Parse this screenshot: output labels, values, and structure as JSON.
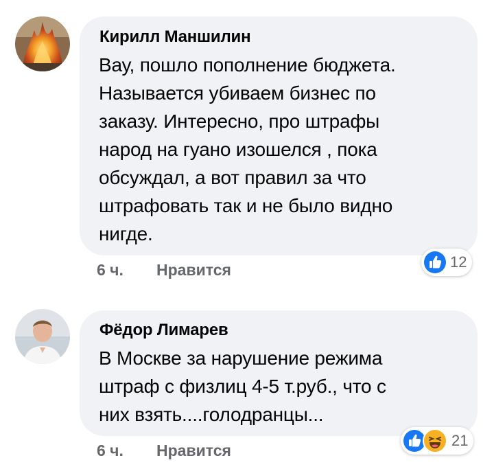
{
  "comments": [
    {
      "author": "Кирилл Маншилин",
      "text": "Вау, пошло пополнение бюджета.\nНазывается убиваем бизнес по\nзаказу. Интересно, про штрафы\nнарод на гуано изошелся , пока\nобсуждал, а вот правил за что\nштрафовать так и не было видно\nнигде.",
      "time": "6 ч.",
      "like_label": "Нравится",
      "reaction_count": "12",
      "reactions": [
        "like-icon"
      ]
    },
    {
      "author": "Фёдор Лимарев",
      "text": "В Москве за нарушение режима\nштраф с физлиц 4-5 т.руб.,  что с\nних взять....голодранцы...",
      "time": "6 ч.",
      "like_label": "Нравится",
      "reaction_count": "21",
      "reactions": [
        "like-icon",
        "haha-icon"
      ]
    }
  ],
  "colors": {
    "bubble": "#f0f2f5",
    "meta": "#65676b",
    "like_blue": "#1877f2",
    "haha_yellow": "#f7b125"
  }
}
